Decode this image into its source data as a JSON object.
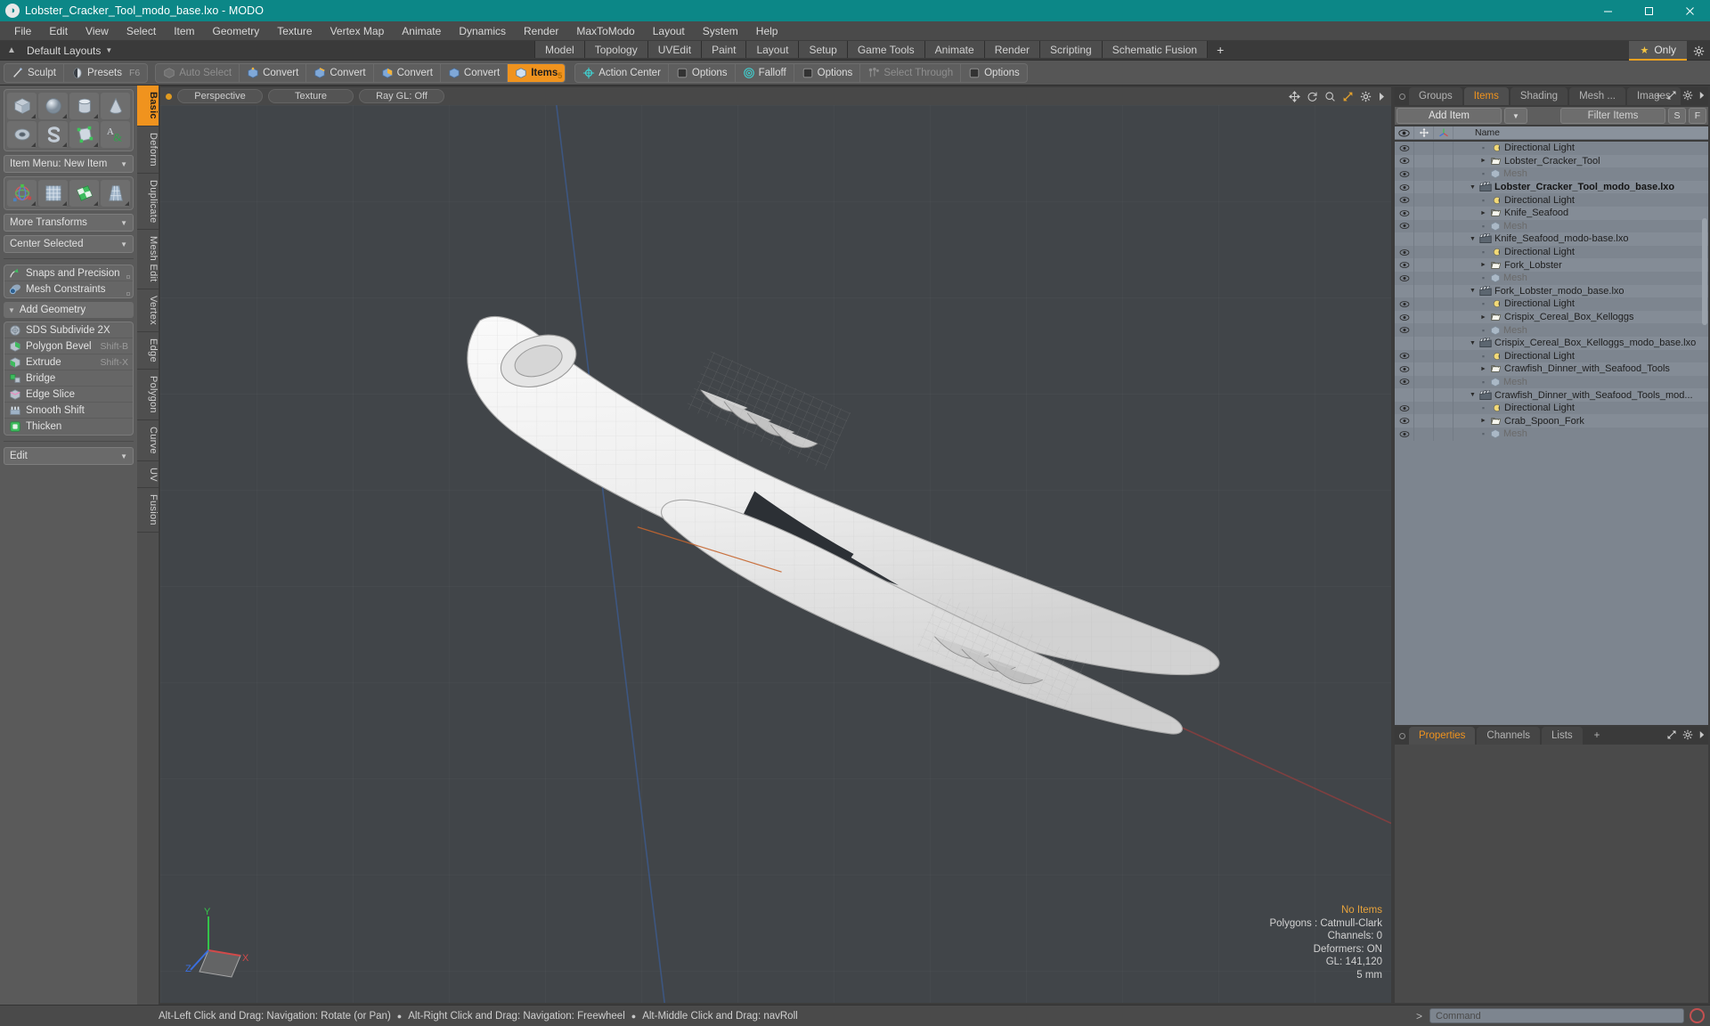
{
  "titlebar": {
    "title": "Lobster_Cracker_Tool_modo_base.lxo - MODO",
    "app_icon": "modo-logo-icon",
    "minimize": "minimize-icon",
    "maximize": "maximize-icon",
    "close": "close-icon"
  },
  "menubar": {
    "items": [
      {
        "label": "File"
      },
      {
        "label": "Edit"
      },
      {
        "label": "View"
      },
      {
        "label": "Select"
      },
      {
        "label": "Item"
      },
      {
        "label": "Geometry"
      },
      {
        "label": "Texture"
      },
      {
        "label": "Vertex Map"
      },
      {
        "label": "Animate"
      },
      {
        "label": "Dynamics"
      },
      {
        "label": "Render"
      },
      {
        "label": "MaxToModo"
      },
      {
        "label": "Layout"
      },
      {
        "label": "System"
      },
      {
        "label": "Help"
      }
    ]
  },
  "layoutbar": {
    "default_layouts": "Default Layouts",
    "tabs": [
      {
        "label": "Model"
      },
      {
        "label": "Topology"
      },
      {
        "label": "UVEdit"
      },
      {
        "label": "Paint"
      },
      {
        "label": "Layout"
      },
      {
        "label": "Setup"
      },
      {
        "label": "Game Tools"
      },
      {
        "label": "Animate"
      },
      {
        "label": "Render"
      },
      {
        "label": "Scripting"
      },
      {
        "label": "Schematic Fusion"
      }
    ],
    "add_label": "+",
    "only_label": "Only",
    "accent": "#f0931e"
  },
  "toolbar": {
    "group1": [
      {
        "label": "Sculpt",
        "icon": "sculpt-brush-icon",
        "state": "normal"
      },
      {
        "label": "Presets",
        "icon": "presets-sphere-icon",
        "state": "normal",
        "kbd": "F6"
      }
    ],
    "group2": [
      {
        "label": "Auto Select",
        "icon": "cube-grey-icon",
        "state": "disabled"
      },
      {
        "label": "Convert",
        "icon": "cube-vertex-icon",
        "state": "normal"
      },
      {
        "label": "Convert",
        "icon": "cube-edge-icon",
        "state": "normal"
      },
      {
        "label": "Convert",
        "icon": "cube-polygon-icon",
        "state": "normal"
      },
      {
        "label": "Convert",
        "icon": "cube-material-icon",
        "state": "normal"
      },
      {
        "label": "Items",
        "icon": "cube-items-icon",
        "state": "active",
        "hot": "5"
      }
    ],
    "group3": [
      {
        "label": "Action Center",
        "icon": "action-center-icon",
        "state": "normal"
      },
      {
        "label": "Options",
        "icon": "options-box-icon",
        "state": "normal"
      },
      {
        "label": "Falloff",
        "icon": "falloff-target-icon",
        "state": "normal"
      },
      {
        "label": "Options",
        "icon": "options-box-icon",
        "state": "normal"
      },
      {
        "label": "Select Through",
        "icon": "select-through-icon",
        "state": "disabled"
      },
      {
        "label": "Options",
        "icon": "options-box-icon",
        "state": "normal"
      }
    ]
  },
  "leftpanel": {
    "rail_tabs": [
      {
        "label": "Basic",
        "active": true
      },
      {
        "label": "Deform",
        "active": false
      },
      {
        "label": "Duplicate",
        "active": false
      },
      {
        "label": "Mesh Edit",
        "active": false
      },
      {
        "label": "Vertex",
        "active": false
      },
      {
        "label": "Edge",
        "active": false
      },
      {
        "label": "Polygon",
        "active": false
      },
      {
        "label": "Curve",
        "active": false
      },
      {
        "label": "UV",
        "active": false
      },
      {
        "label": "Fusion",
        "active": false
      }
    ],
    "primitives_row1": [
      {
        "name": "cube-primitive",
        "icon": "cube-icon"
      },
      {
        "name": "sphere-primitive",
        "icon": "sphere-icon"
      },
      {
        "name": "cylinder-primitive",
        "icon": "cylinder-icon"
      },
      {
        "name": "cone-primitive",
        "icon": "cone-icon"
      }
    ],
    "primitives_row2": [
      {
        "name": "torus-primitive",
        "icon": "torus-icon"
      },
      {
        "name": "spiral-primitive",
        "icon": "spiral-icon"
      },
      {
        "name": "polygon-pen",
        "icon": "pen-polygon-icon"
      },
      {
        "name": "text-tool",
        "icon": "text-ampersand-icon"
      }
    ],
    "item_menu": "Item Menu: New Item",
    "transform_row": [
      {
        "name": "transform-gizmo",
        "icon": "transform-axis-icon"
      },
      {
        "name": "mesh-grid",
        "icon": "mesh-grid-icon"
      },
      {
        "name": "uv-checker",
        "icon": "uv-checker-icon"
      },
      {
        "name": "taper-tool",
        "icon": "taper-icon"
      }
    ],
    "more_transforms": "More Transforms",
    "center_selected": "Center Selected",
    "snaps": {
      "label": "Snaps and Precision",
      "icon": "snap-arrow-icon"
    },
    "constraints": {
      "label": "Mesh Constraints",
      "icon": "constraint-icon"
    },
    "add_geometry_header": "Add Geometry",
    "geometry_ops": [
      {
        "label": "SDS Subdivide 2X",
        "icon": "sds-subdivide-icon",
        "kbd": ""
      },
      {
        "label": "Polygon Bevel",
        "icon": "polygon-bevel-icon",
        "kbd": "Shift-B"
      },
      {
        "label": "Extrude",
        "icon": "extrude-icon",
        "kbd": "Shift-X"
      },
      {
        "label": "Bridge",
        "icon": "bridge-icon",
        "kbd": ""
      },
      {
        "label": "Edge Slice",
        "icon": "edge-slice-icon",
        "kbd": ""
      },
      {
        "label": "Smooth Shift",
        "icon": "smooth-shift-icon",
        "kbd": ""
      },
      {
        "label": "Thicken",
        "icon": "thicken-icon",
        "kbd": ""
      }
    ],
    "edit_dropdown": "Edit"
  },
  "viewport": {
    "header": {
      "view_mode": "Perspective",
      "shading": "Texture",
      "raygl": "Ray GL: Off",
      "tools": [
        "move-icon",
        "rotate-icon",
        "zoom-magnifier-icon",
        "fit-expand-icon",
        "gear-icon",
        "chevron-right-icon"
      ]
    },
    "stats": {
      "items": "No Items",
      "polygons": "Polygons : Catmull-Clark",
      "channels": "Channels: 0",
      "deformers": "Deformers: ON",
      "gl": "GL: 141,120",
      "scale": "5 mm"
    },
    "axis": {
      "x": "X",
      "y": "Y",
      "z": "Z"
    }
  },
  "rightpanel": {
    "tabs": [
      {
        "label": "Groups",
        "active": false
      },
      {
        "label": "Items",
        "active": true
      },
      {
        "label": "Shading",
        "active": false
      },
      {
        "label": "Mesh ...",
        "active": false
      },
      {
        "label": "Images",
        "active": false
      }
    ],
    "tab_add": "+",
    "tab_tools": [
      "expand-icon",
      "gear-icon",
      "chevron-right-icon"
    ],
    "add_item": "Add Item",
    "filter_placeholder": "Filter Items",
    "btn_s": "S",
    "btn_f": "F",
    "columns": {
      "visibility": "eye-icon",
      "lock": "move-lock-icon",
      "axis": "axis-icon",
      "name": "Name"
    },
    "rows": [
      {
        "label": "Mesh",
        "icon": "mesh-icon",
        "depth": 1,
        "toggle": "dot",
        "eye": true,
        "dim": true,
        "bold": false
      },
      {
        "label": "Crab_Spoon_Fork",
        "icon": "folder-icon",
        "depth": 1,
        "toggle": "right",
        "eye": true,
        "dim": false,
        "bold": false
      },
      {
        "label": "Directional Light",
        "icon": "light-icon",
        "depth": 1,
        "toggle": "dot",
        "eye": true,
        "dim": false,
        "bold": false
      },
      {
        "label": "Crawfish_Dinner_with_Seafood_Tools_mod...",
        "icon": "scene-icon",
        "depth": 0,
        "toggle": "down",
        "eye": false,
        "dim": false,
        "bold": false
      },
      {
        "label": "Mesh",
        "icon": "mesh-icon",
        "depth": 1,
        "toggle": "dot",
        "eye": true,
        "dim": true,
        "bold": false
      },
      {
        "label": "Crawfish_Dinner_with_Seafood_Tools",
        "icon": "folder-icon",
        "depth": 1,
        "toggle": "right",
        "eye": true,
        "dim": false,
        "bold": false
      },
      {
        "label": "Directional Light",
        "icon": "light-icon",
        "depth": 1,
        "toggle": "dot",
        "eye": true,
        "dim": false,
        "bold": false
      },
      {
        "label": "Crispix_Cereal_Box_Kelloggs_modo_base.lxo",
        "icon": "scene-icon",
        "depth": 0,
        "toggle": "down",
        "eye": false,
        "dim": false,
        "bold": false
      },
      {
        "label": "Mesh",
        "icon": "mesh-icon",
        "depth": 1,
        "toggle": "dot",
        "eye": true,
        "dim": true,
        "bold": false
      },
      {
        "label": "Crispix_Cereal_Box_Kelloggs",
        "icon": "folder-icon",
        "depth": 1,
        "toggle": "right",
        "eye": true,
        "dim": false,
        "bold": false
      },
      {
        "label": "Directional Light",
        "icon": "light-icon",
        "depth": 1,
        "toggle": "dot",
        "eye": true,
        "dim": false,
        "bold": false
      },
      {
        "label": "Fork_Lobster_modo_base.lxo",
        "icon": "scene-icon",
        "depth": 0,
        "toggle": "down",
        "eye": false,
        "dim": false,
        "bold": false
      },
      {
        "label": "Mesh",
        "icon": "mesh-icon",
        "depth": 1,
        "toggle": "dot",
        "eye": true,
        "dim": true,
        "bold": false
      },
      {
        "label": "Fork_Lobster",
        "icon": "folder-icon",
        "depth": 1,
        "toggle": "right",
        "eye": true,
        "dim": false,
        "bold": false
      },
      {
        "label": "Directional Light",
        "icon": "light-icon",
        "depth": 1,
        "toggle": "dot",
        "eye": true,
        "dim": false,
        "bold": false
      },
      {
        "label": "Knife_Seafood_modo-base.lxo",
        "icon": "scene-icon",
        "depth": 0,
        "toggle": "down",
        "eye": false,
        "dim": false,
        "bold": false
      },
      {
        "label": "Mesh",
        "icon": "mesh-icon",
        "depth": 1,
        "toggle": "dot",
        "eye": true,
        "dim": true,
        "bold": false
      },
      {
        "label": "Knife_Seafood",
        "icon": "folder-icon",
        "depth": 1,
        "toggle": "right",
        "eye": true,
        "dim": false,
        "bold": false
      },
      {
        "label": "Directional Light",
        "icon": "light-icon",
        "depth": 1,
        "toggle": "dot",
        "eye": true,
        "dim": false,
        "bold": false
      },
      {
        "label": "Lobster_Cracker_Tool_modo_base.lxo",
        "icon": "scene-icon",
        "depth": 0,
        "toggle": "down",
        "eye": true,
        "dim": false,
        "bold": true
      },
      {
        "label": "Mesh",
        "icon": "mesh-icon",
        "depth": 1,
        "toggle": "dot",
        "eye": true,
        "dim": true,
        "bold": false
      },
      {
        "label": "Lobster_Cracker_Tool",
        "icon": "folder-icon",
        "depth": 1,
        "toggle": "right",
        "eye": true,
        "dim": false,
        "bold": false
      },
      {
        "label": "Directional Light",
        "icon": "light-icon",
        "depth": 1,
        "toggle": "dot",
        "eye": true,
        "dim": false,
        "bold": false
      }
    ],
    "bottom_tabs": [
      {
        "label": "Properties",
        "active": true
      },
      {
        "label": "Channels",
        "active": false
      },
      {
        "label": "Lists",
        "active": false
      }
    ],
    "bottom_tab_add": "+"
  },
  "statusbar": {
    "hints": [
      "Alt-Left Click and Drag: Navigation: Rotate (or Pan)",
      "Alt-Right Click and Drag: Navigation: Freewheel",
      "Alt-Middle Click and Drag: navRoll"
    ],
    "prompt": ">",
    "command_placeholder": "Command",
    "record": "record-icon"
  }
}
